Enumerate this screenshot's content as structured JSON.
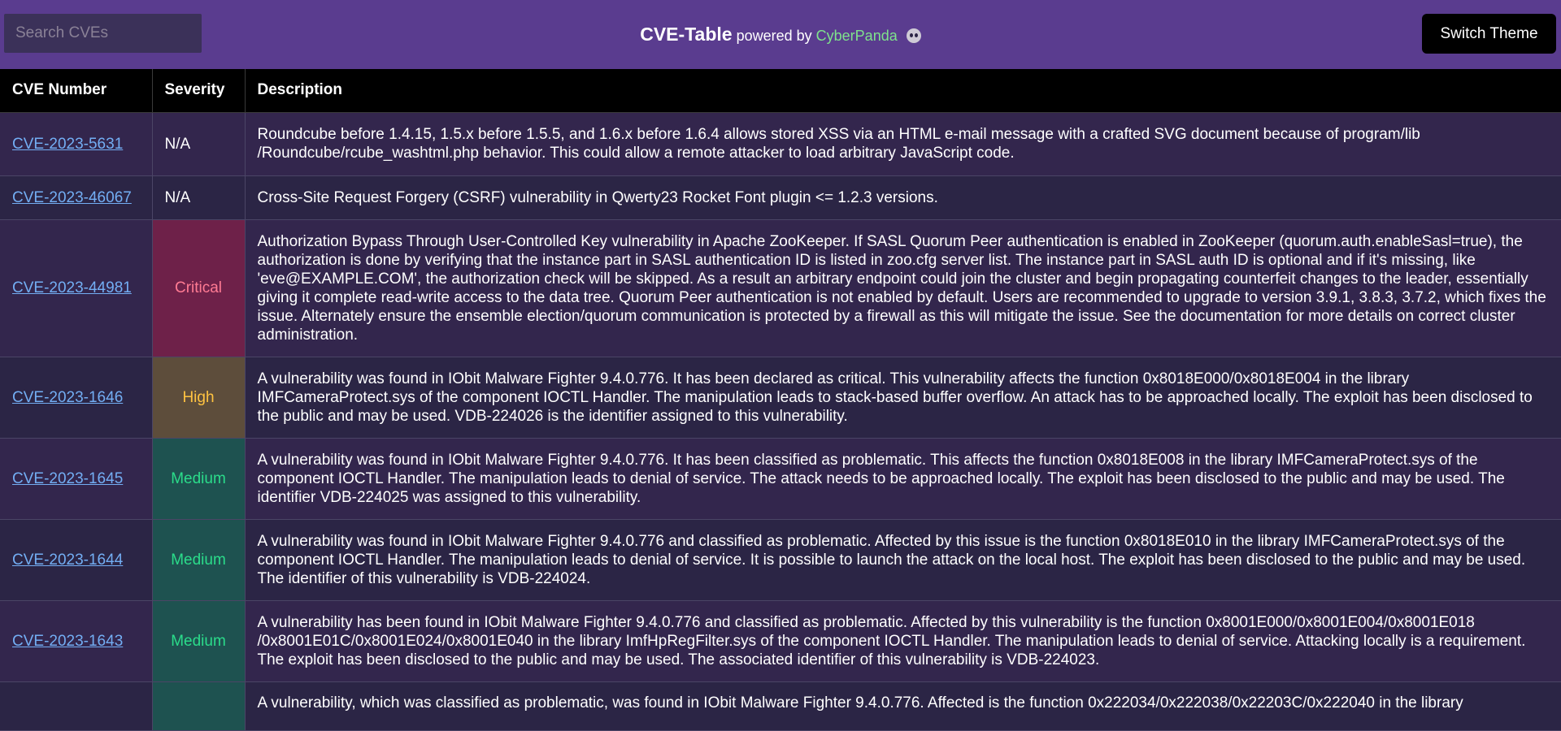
{
  "search": {
    "placeholder": "Search CVEs",
    "value": ""
  },
  "brand": {
    "title": "CVE-Table",
    "powered_by": "powered by",
    "company": "CyberPanda",
    "accent": "#7fe38c"
  },
  "theme_button": {
    "label": "Switch Theme"
  },
  "table": {
    "headers": [
      "CVE Number",
      "Severity",
      "Description"
    ],
    "rows": [
      {
        "cve": "CVE-2023-5631",
        "severity": "N/A",
        "description": "Roundcube before 1.4.15, 1.5.x before 1.5.5, and 1.6.x before 1.6.4 allows stored XSS via an HTML e-mail message with a crafted SVG document because of program/lib /Roundcube/rcube_washtml.php behavior. This could allow a remote attacker to load arbitrary JavaScript code."
      },
      {
        "cve": "CVE-2023-46067",
        "severity": "N/A",
        "description": "Cross-Site Request Forgery (CSRF) vulnerability in Qwerty23 Rocket Font plugin <= 1.2.3 versions."
      },
      {
        "cve": "CVE-2023-44981",
        "severity": "Critical",
        "description": "Authorization Bypass Through User-Controlled Key vulnerability in Apache ZooKeeper. If SASL Quorum Peer authentication is enabled in ZooKeeper (quorum.auth.enableSasl=true), the authorization is done by verifying that the instance part in SASL authentication ID is listed in zoo.cfg server list. The instance part in SASL auth ID is optional and if it's missing, like 'eve@EXAMPLE.COM', the authorization check will be skipped. As a result an arbitrary endpoint could join the cluster and begin propagating counterfeit changes to the leader, essentially giving it complete read-write access to the data tree. Quorum Peer authentication is not enabled by default. Users are recommended to upgrade to version 3.9.1, 3.8.3, 3.7.2, which fixes the issue. Alternately ensure the ensemble election/quorum communication is protected by a firewall as this will mitigate the issue. See the documentation for more details on correct cluster administration."
      },
      {
        "cve": "CVE-2023-1646",
        "severity": "High",
        "description": "A vulnerability was found in IObit Malware Fighter 9.4.0.776. It has been declared as critical. This vulnerability affects the function 0x8018E000/0x8018E004 in the library IMFCameraProtect.sys of the component IOCTL Handler. The manipulation leads to stack-based buffer overflow. An attack has to be approached locally. The exploit has been disclosed to the public and may be used. VDB-224026 is the identifier assigned to this vulnerability."
      },
      {
        "cve": "CVE-2023-1645",
        "severity": "Medium",
        "description": "A vulnerability was found in IObit Malware Fighter 9.4.0.776. It has been classified as problematic. This affects the function 0x8018E008 in the library IMFCameraProtect.sys of the component IOCTL Handler. The manipulation leads to denial of service. The attack needs to be approached locally. The exploit has been disclosed to the public and may be used. The identifier VDB-224025 was assigned to this vulnerability."
      },
      {
        "cve": "CVE-2023-1644",
        "severity": "Medium",
        "description": "A vulnerability was found in IObit Malware Fighter 9.4.0.776 and classified as problematic. Affected by this issue is the function 0x8018E010 in the library IMFCameraProtect.sys of the component IOCTL Handler. The manipulation leads to denial of service. It is possible to launch the attack on the local host. The exploit has been disclosed to the public and may be used. The identifier of this vulnerability is VDB-224024."
      },
      {
        "cve": "CVE-2023-1643",
        "severity": "Medium",
        "description": "A vulnerability has been found in IObit Malware Fighter 9.4.0.776 and classified as problematic. Affected by this vulnerability is the function 0x8001E000/0x8001E004/0x8001E018 /0x8001E01C/0x8001E024/0x8001E040 in the library ImfHpRegFilter.sys of the component IOCTL Handler. The manipulation leads to denial of service. Attacking locally is a requirement. The exploit has been disclosed to the public and may be used. The associated identifier of this vulnerability is VDB-224023."
      },
      {
        "cve": "",
        "severity": "",
        "description": "A vulnerability, which was classified as problematic, was found in IObit Malware Fighter 9.4.0.776. Affected is the function 0x222034/0x222038/0x22203C/0x222040 in the library"
      }
    ]
  },
  "colors": {
    "header_bar": "#5a3c8f",
    "critical": "#ff7b93",
    "high": "#ffc341",
    "medium": "#2bdc8a",
    "link": "#73aef4"
  }
}
